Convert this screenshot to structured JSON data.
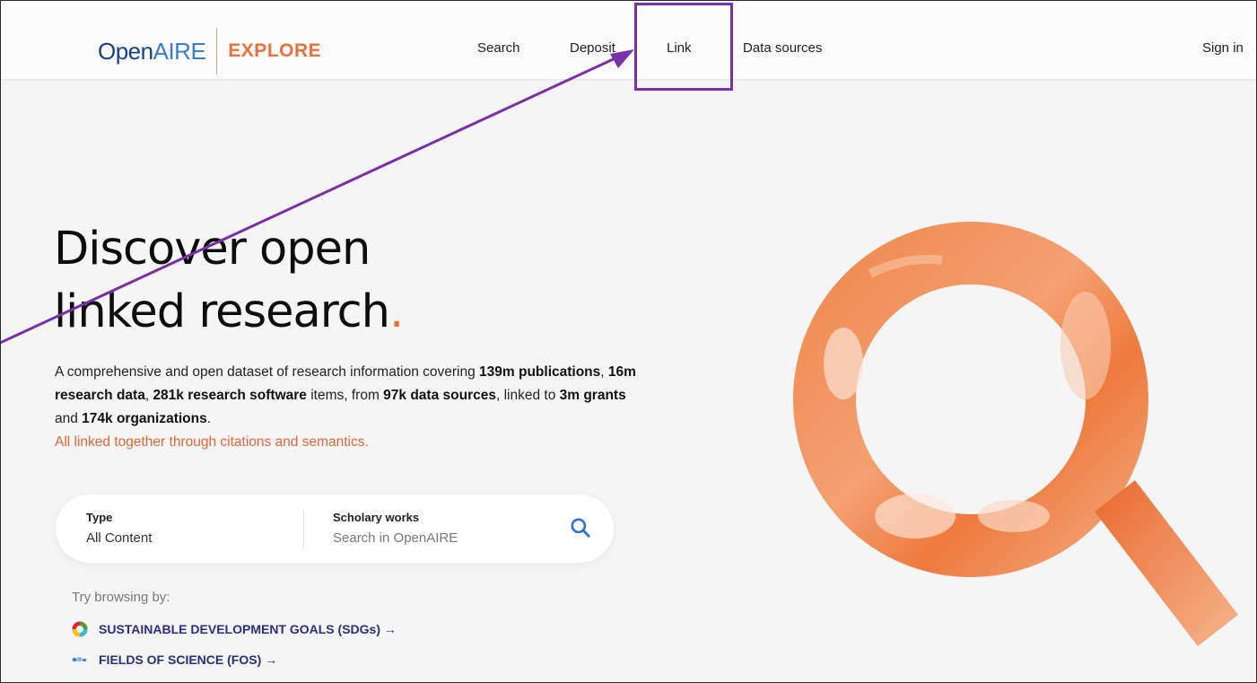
{
  "header": {
    "logo_open": "Open",
    "logo_aire": "AIRE",
    "logo_explore": "EXPLORE",
    "nav": [
      "Search",
      "Deposit",
      "Link",
      "Data sources"
    ],
    "signin": "Sign in"
  },
  "hero": {
    "title_line1": "Discover open",
    "title_line2": "linked research",
    "title_dot": ".",
    "desc_parts": [
      "A comprehensive and open dataset of research information covering ",
      "139m publications",
      ", ",
      "16m research data",
      ", ",
      "281k research software",
      " items, from ",
      "97k data sources",
      ", linked to ",
      "3m grants",
      " and ",
      "174k organizations",
      "."
    ],
    "tagline": "All linked together through citations and semantics."
  },
  "search": {
    "type_label": "Type",
    "type_value": "All Content",
    "works_label": "Scholary works",
    "placeholder": "Search in OpenAIRE",
    "icon": "search-icon"
  },
  "browse": {
    "label": "Try browsing by:",
    "links": [
      {
        "label": "SUSTAINABLE DEVELOPMENT GOALS (SDGs) →",
        "icon": "sdg-wheel-icon"
      },
      {
        "label": "FIELDS OF SCIENCE (FOS) →",
        "icon": "fos-icon"
      }
    ]
  },
  "colors": {
    "accent": "#e8713c",
    "brand_dark": "#1c3f8a",
    "brand_light": "#3a7bd5",
    "link": "#2a2e80",
    "annotation": "#7b2fa8"
  }
}
